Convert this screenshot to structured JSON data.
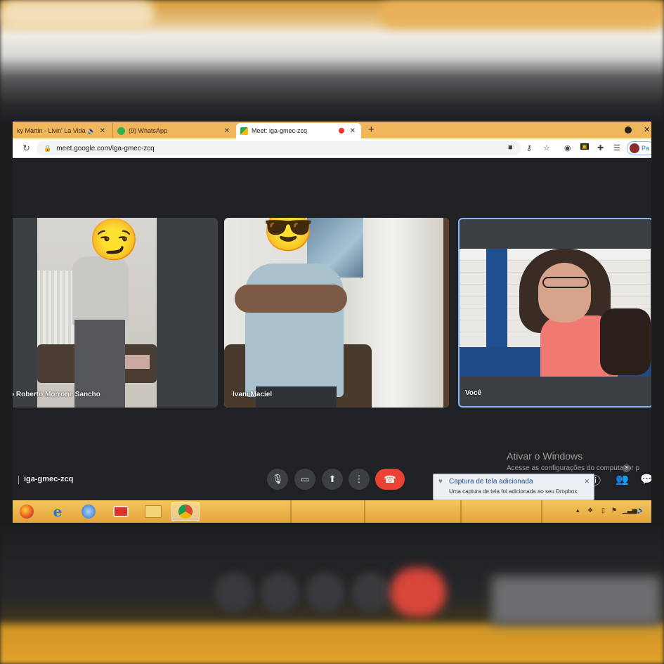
{
  "browser": {
    "tabs": [
      {
        "label": "ky Martin - Livin' La Vida",
        "icon": "speaker-icon"
      },
      {
        "label": "(9) WhatsApp",
        "icon": "whatsapp-icon"
      },
      {
        "label": "Meet: iga-gmec-zcq",
        "icon": "meet-icon"
      }
    ],
    "url": "meet.google.com/iga-gmec-zcq",
    "profile_label": "Pa"
  },
  "participants": [
    {
      "name": "o Roberto Morrone Sancho",
      "emoji": "😏"
    },
    {
      "name": "Ivani Maciel",
      "emoji": "😎"
    },
    {
      "name": "Você"
    }
  ],
  "meeting": {
    "code": "iga-gmec-zcq",
    "participant_count": "3"
  },
  "watermark": {
    "title": "Ativar o Windows",
    "subtitle": "Acesse as configurações do computador p"
  },
  "notification": {
    "title": "Captura de tela adicionada",
    "body": "Uma captura de tela foi adicionada ao seu Dropbox."
  },
  "colors": {
    "accent": "#8ab4f8",
    "end_call": "#ea4335",
    "taskbar": "#e4a53a",
    "tabbar": "#f0b65b"
  }
}
